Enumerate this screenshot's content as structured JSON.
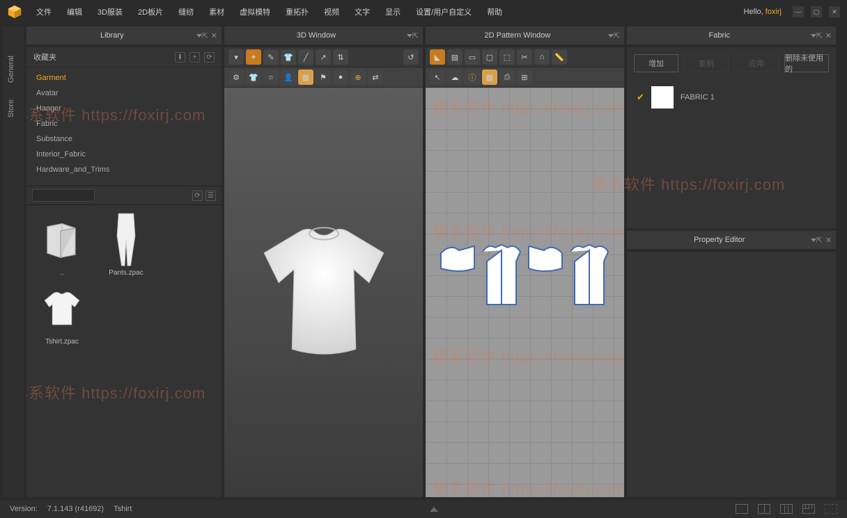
{
  "menu": [
    "文件",
    "编辑",
    "3D服装",
    "2D板片",
    "缝纫",
    "素材",
    "虚拟模特",
    "重拓扑",
    "视频",
    "文字",
    "显示",
    "设置/用户自定义",
    "帮助"
  ],
  "hello": {
    "prefix": "Hello, ",
    "user": "foxirj"
  },
  "vtabs": [
    "General",
    "Store"
  ],
  "panels": {
    "library": "Library",
    "window3d": "3D Window",
    "window2d": "2D Pattern Window",
    "fabric": "Fabric",
    "property": "Property Editor"
  },
  "library": {
    "favorites": "收藏夹",
    "tree": [
      "Garment",
      "Avatar",
      "Hanger",
      "Fabric",
      "Substance",
      "Interior_Fabric",
      "Hardware_and_Trims"
    ],
    "items": [
      {
        "label": ".."
      },
      {
        "label": "Pants.zpac"
      },
      {
        "label": "Tshirt.zpac"
      }
    ]
  },
  "fabric": {
    "buttons": [
      "增加",
      "复制",
      "应用",
      "删除未使用的"
    ],
    "item": "FABRIC 1"
  },
  "status": {
    "versionLabel": "Version:",
    "version": "7.1.143 (r41692)",
    "file": "Tshirt"
  },
  "watermark": "佛系软件 https://foxirj.com"
}
